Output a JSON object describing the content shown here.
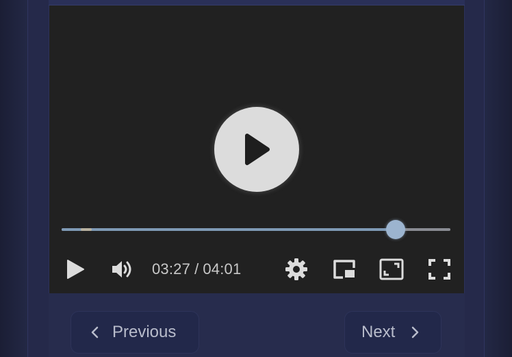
{
  "player": {
    "current_time": "03:27",
    "separator": "/",
    "duration": "04:01",
    "progress_fraction": 0.859,
    "buffered_fraction": 0.077,
    "colors": {
      "video_bg": "#212121",
      "progress_fill": "#7f9ab5",
      "thumb": "#9cb4cf",
      "icon": "#dcdcdc"
    }
  },
  "controls": {
    "play_icon": "play-icon",
    "volume_icon": "volume-icon",
    "settings_icon": "gear-icon",
    "pip_icon": "picture-in-picture-icon",
    "theater_icon": "theater-mode-icon",
    "fullscreen_icon": "fullscreen-icon"
  },
  "navigation": {
    "previous_label": "Previous",
    "next_label": "Next"
  }
}
